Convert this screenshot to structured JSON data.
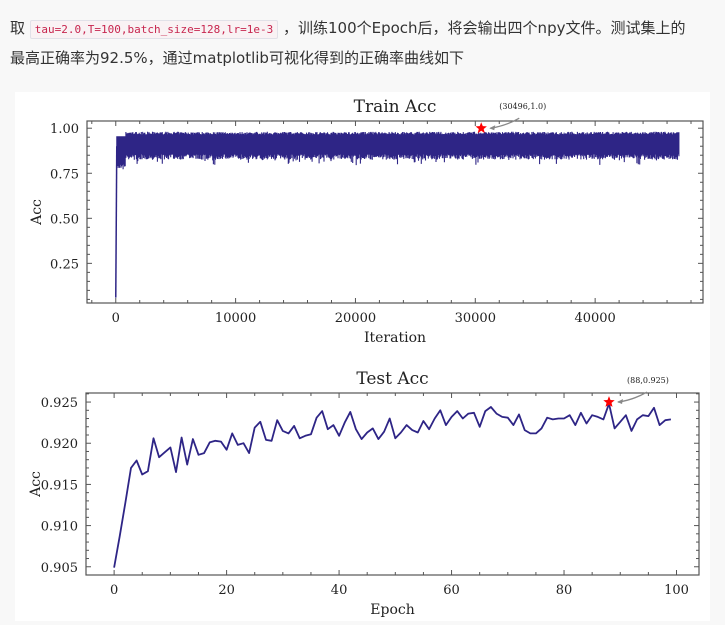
{
  "intro": {
    "prefix": "取",
    "code": "tau=2.0,T=100,batch_size=128,lr=1e-3",
    "line1_rest": "，训练100个Epoch后，将会输出四个npy文件。测试集上的",
    "line2": "最高正确率为92.5%，通过matplotlib可视化得到的正确率曲线如下"
  },
  "chart_data": [
    {
      "type": "line",
      "title": "Train Acc",
      "xlabel": "Iteration",
      "ylabel": "Acc",
      "xlim": [
        -2400,
        49000
      ],
      "ylim": [
        0.03,
        1.04
      ],
      "xticks": [
        0,
        10000,
        20000,
        30000,
        40000
      ],
      "xtick_labels": [
        "0",
        "10000",
        "20000",
        "30000",
        "40000"
      ],
      "yticks": [
        0.25,
        0.5,
        0.75,
        1.0
      ],
      "ytick_labels": [
        "0.25",
        "0.50",
        "0.75",
        "1.00"
      ],
      "grid": false,
      "series": [
        {
          "name": "train_acc",
          "color": "#2e2586",
          "summary": "starts near 0.06 at iteration 0, rises sharply to ~0.9 within first ~500 iterations, then oscillates in band ~0.84-0.98 through ~47000 iterations",
          "x": [
            0,
            100,
            300,
            600,
            1000,
            47000
          ],
          "band_low": [
            0.06,
            0.78,
            0.82,
            0.84,
            0.85,
            0.86
          ],
          "band_high": [
            0.06,
            0.94,
            0.96,
            0.97,
            0.98,
            0.98
          ],
          "end_iteration": 47000
        }
      ],
      "annotation": {
        "text": "(30496,1.0)",
        "x": 30496,
        "y": 1.0,
        "marker": "star",
        "marker_color": "#ff0000",
        "arrow_color": "#888888"
      }
    },
    {
      "type": "line",
      "title": "Test Acc",
      "xlabel": "Epoch",
      "ylabel": "Acc",
      "xlim": [
        -5,
        104
      ],
      "ylim": [
        0.904,
        0.9261
      ],
      "xticks": [
        0,
        20,
        40,
        60,
        80,
        100
      ],
      "xtick_labels": [
        "0",
        "20",
        "40",
        "60",
        "80",
        "100"
      ],
      "yticks": [
        0.905,
        0.91,
        0.915,
        0.92,
        0.925
      ],
      "ytick_labels": [
        "0.905",
        "0.910",
        "0.915",
        "0.920",
        "0.925"
      ],
      "grid": false,
      "series": [
        {
          "name": "test_acc",
          "color": "#2e2586",
          "x": [
            0,
            1,
            2,
            3,
            4,
            5,
            6,
            7,
            8,
            9,
            10,
            11,
            12,
            13,
            14,
            15,
            16,
            17,
            18,
            19,
            20,
            21,
            22,
            23,
            24,
            25,
            26,
            27,
            28,
            29,
            30,
            31,
            32,
            33,
            34,
            35,
            36,
            37,
            38,
            39,
            40,
            41,
            42,
            43,
            44,
            45,
            46,
            47,
            48,
            49,
            50,
            51,
            52,
            53,
            54,
            55,
            56,
            57,
            58,
            59,
            60,
            61,
            62,
            63,
            64,
            65,
            66,
            67,
            68,
            69,
            70,
            71,
            72,
            73,
            74,
            75,
            76,
            77,
            78,
            79,
            80,
            81,
            82,
            83,
            84,
            85,
            86,
            87,
            88,
            89,
            90,
            91,
            92,
            93,
            94,
            95,
            96,
            97,
            98,
            99
          ],
          "values": [
            0.9049,
            0.9087,
            0.9128,
            0.917,
            0.9179,
            0.9162,
            0.9166,
            0.9206,
            0.9183,
            0.9189,
            0.9195,
            0.9165,
            0.9207,
            0.9174,
            0.9205,
            0.9186,
            0.9188,
            0.9201,
            0.9203,
            0.9202,
            0.9192,
            0.9212,
            0.9198,
            0.92,
            0.9188,
            0.9219,
            0.9226,
            0.9204,
            0.9203,
            0.9228,
            0.9215,
            0.9212,
            0.9221,
            0.9206,
            0.9209,
            0.9211,
            0.9231,
            0.9239,
            0.9217,
            0.9222,
            0.9209,
            0.9225,
            0.9238,
            0.9217,
            0.9205,
            0.9213,
            0.9218,
            0.9205,
            0.9214,
            0.923,
            0.9206,
            0.9213,
            0.9222,
            0.9216,
            0.9213,
            0.9227,
            0.9217,
            0.923,
            0.924,
            0.9222,
            0.9232,
            0.9239,
            0.923,
            0.9236,
            0.9237,
            0.922,
            0.9239,
            0.9244,
            0.9236,
            0.9232,
            0.9231,
            0.9222,
            0.9235,
            0.9216,
            0.9212,
            0.9212,
            0.9218,
            0.9231,
            0.9229,
            0.923,
            0.923,
            0.9234,
            0.9222,
            0.9237,
            0.9224,
            0.9234,
            0.9232,
            0.9229,
            0.9248,
            0.9218,
            0.9226,
            0.9234,
            0.9215,
            0.9229,
            0.9234,
            0.9233,
            0.9243,
            0.9222,
            0.9228,
            0.9229
          ]
        }
      ],
      "annotation": {
        "text": "(88,0.925)",
        "x": 88,
        "y": 0.925,
        "marker": "star",
        "marker_color": "#ff0000",
        "arrow_color": "#888888"
      }
    }
  ]
}
